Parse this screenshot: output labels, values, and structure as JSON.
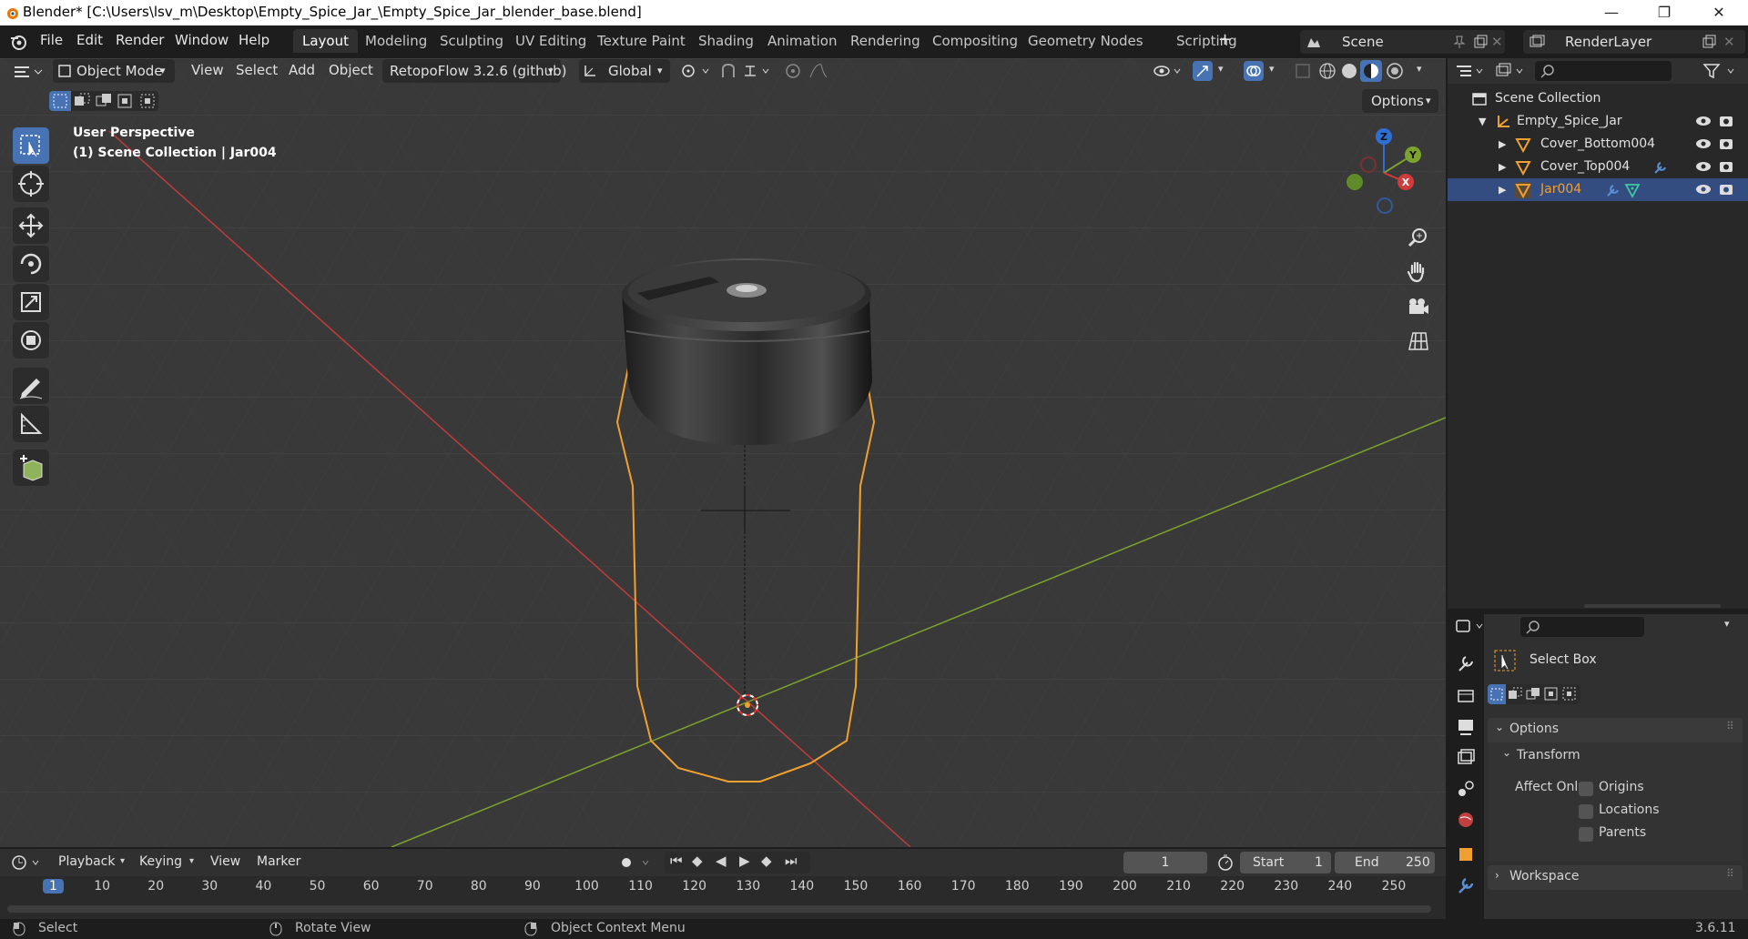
{
  "window": {
    "title": "Blender* [C:\\Users\\lsv_m\\Desktop\\Empty_Spice_Jar_\\Empty_Spice_Jar_blender_base.blend]",
    "minimize": "—",
    "maximize": "❐",
    "close": "✕"
  },
  "menu": [
    "File",
    "Edit",
    "Render",
    "Window",
    "Help"
  ],
  "workspaces": [
    "Layout",
    "Modeling",
    "Sculpting",
    "UV Editing",
    "Texture Paint",
    "Shading",
    "Animation",
    "Rendering",
    "Compositing",
    "Geometry Nodes",
    "Scripting"
  ],
  "active_workspace": "Layout",
  "add_workspace": "+",
  "scene": {
    "name": "Scene"
  },
  "view_layer": {
    "name": "RenderLayer"
  },
  "viewport_header": {
    "mode": "Object Mode",
    "menus": [
      "View",
      "Select",
      "Add",
      "Object"
    ],
    "addon": "RetopoFlow 3.2.6 (github)",
    "orientation": "Global",
    "options": "Options"
  },
  "viewport_overlay": {
    "perspective": "User Perspective",
    "context": "(1) Scene Collection | Jar004"
  },
  "gizmo": {
    "x": "X",
    "y": "Y",
    "z": "Z"
  },
  "outliner": {
    "search_placeholder": "",
    "root": "Scene Collection",
    "items": [
      {
        "name": "Empty_Spice_Jar",
        "type": "empty",
        "selected": false
      },
      {
        "name": "Cover_Bottom004",
        "type": "mesh",
        "selected": false
      },
      {
        "name": "Cover_Top004",
        "type": "mesh",
        "selected": false
      },
      {
        "name": "Jar004",
        "type": "mesh",
        "selected": true
      }
    ]
  },
  "properties": {
    "tool_name": "Select Box",
    "options_label": "Options",
    "transform_label": "Transform",
    "affect_only_label": "Affect Only",
    "checkboxes": [
      "Origins",
      "Locations",
      "Parents"
    ],
    "workspace_label": "Workspace"
  },
  "timeline": {
    "menus": [
      "Playback",
      "Keying",
      "View",
      "Marker"
    ],
    "current_frame": "1",
    "start_label": "Start",
    "start": "1",
    "end_label": "End",
    "end": "250",
    "ruler": [
      "1",
      "10",
      "20",
      "30",
      "40",
      "50",
      "60",
      "70",
      "80",
      "90",
      "100",
      "110",
      "120",
      "130",
      "140",
      "150",
      "160",
      "170",
      "180",
      "190",
      "200",
      "210",
      "220",
      "230",
      "240",
      "250"
    ]
  },
  "statusbar": {
    "select": "Select",
    "rotate": "Rotate View",
    "context_menu": "Object Context Menu",
    "version": "3.6.11"
  },
  "colors": {
    "accent": "#4772b3",
    "selection_orange": "#f0a030",
    "axis_x": "#c23b3b",
    "axis_y": "#7ea32c"
  }
}
